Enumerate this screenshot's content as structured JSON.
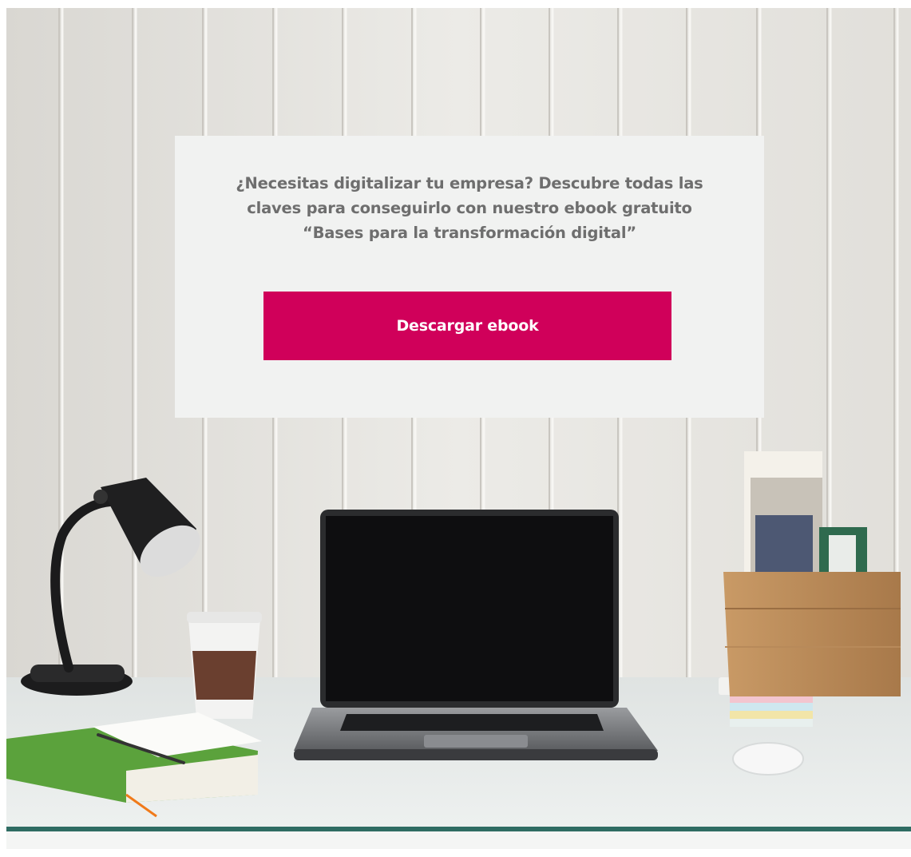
{
  "banner": {
    "text_lines": [
      "¿Necesitas digitalizar tu empresa? Descubre todas las",
      "claves para conseguirlo con  nuestro ebook gratuito",
      "“Bases para la transformación digital”"
    ],
    "cta_label": "Descargar ebook"
  },
  "colors": {
    "accent": "#d0005a",
    "card_background": "#f1f2f1",
    "text": "#6e6e6e"
  },
  "background_photo": {
    "subject": "desk-workspace-with-laptop-lamp-coffee-notebooks",
    "icons": [
      "desk-lamp",
      "coffee-cup",
      "notebook",
      "pen",
      "laptop",
      "sticky-notes",
      "mouse",
      "wooden-file-box"
    ]
  }
}
